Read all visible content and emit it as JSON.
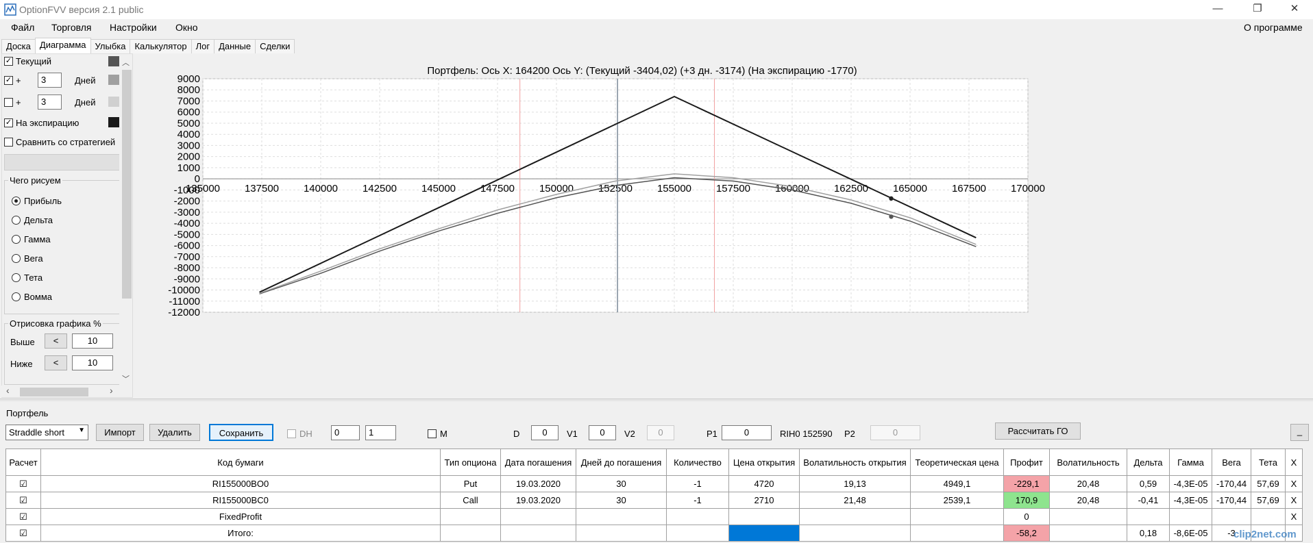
{
  "window": {
    "title": "OptionFVV версия 2.1 public",
    "min": "—",
    "restore": "❐",
    "close": "✕"
  },
  "menu": {
    "items": [
      "Файл",
      "Торговля",
      "Настройки",
      "Окно"
    ],
    "about": "О программе"
  },
  "tabs": [
    "Доска",
    "Диаграмма",
    "Улыбка",
    "Калькулятор",
    "Лог",
    "Данные",
    "Сделки"
  ],
  "left": {
    "current_label": "Текущий",
    "plus_label": "+",
    "days_label": "Дней",
    "days1": "3",
    "days2": "3",
    "expiration_label": "На экспирацию",
    "compare_label": "Сравнить со стратегией",
    "draw_group": "Чего рисуем",
    "draw_options": [
      "Прибыль",
      "Дельта",
      "Гамма",
      "Вега",
      "Тета",
      "Вомма"
    ],
    "render_group": "Отрисовка графика %",
    "above_label": "Выше",
    "below_label": "Ниже",
    "btn_less": "<",
    "above_value": "10",
    "below_value": "10",
    "scroll_up": "︿",
    "scroll_down": "﹀",
    "scroll_left": "‹",
    "scroll_right": "›",
    "colors": {
      "current": "#555555",
      "plus1": "#a0a0a0",
      "plus2": "#d0d0d0",
      "expiration": "#1a1a1a"
    }
  },
  "chart_data": {
    "type": "line",
    "title": "Портфель: Ось X: 164200 Ось Y:  (Текущий -3404,02)  (+3 дн. -3174)  (На экспирацию -1770)",
    "xlim": [
      135000,
      170000
    ],
    "ylim": [
      -12000,
      9000
    ],
    "x_ticks": [
      135000,
      137500,
      140000,
      142500,
      145000,
      147500,
      150000,
      152500,
      155000,
      157500,
      160000,
      162500,
      165000,
      167500,
      170000
    ],
    "y_ticks": [
      9000,
      8000,
      7000,
      6000,
      5000,
      4000,
      3000,
      2000,
      1000,
      0,
      -1000,
      -2000,
      -3000,
      -4000,
      -5000,
      -6000,
      -7000,
      -8000,
      -9000,
      -10000,
      -11000,
      -12000
    ],
    "vlines": {
      "current_price": 152590,
      "red_left": 148450,
      "red_right": 156700
    },
    "series": [
      {
        "x": [
          137400,
          155000,
          167800
        ],
        "y": [
          -10200,
          7400,
          -5300
        ]
      },
      {
        "x": [
          137400,
          140000,
          142500,
          145000,
          147500,
          150000,
          152500,
          155000,
          157500,
          160000,
          162500,
          165000,
          167800
        ],
        "y": [
          -10350,
          -8500,
          -6500,
          -4700,
          -3100,
          -1700,
          -600,
          100,
          -200,
          -1000,
          -2200,
          -3800,
          -6100
        ]
      },
      {
        "x": [
          137400,
          140000,
          142500,
          145000,
          147500,
          150000,
          152500,
          155000,
          157500,
          160000,
          162500,
          165000,
          167800
        ],
        "y": [
          -10300,
          -8300,
          -6300,
          -4500,
          -2800,
          -1400,
          -200,
          450,
          100,
          -700,
          -1900,
          -3500,
          -5900
        ]
      }
    ],
    "markers": [
      {
        "x": 164200,
        "y": -1770
      },
      {
        "x": 164200,
        "y": -3404
      }
    ]
  },
  "portfolio": {
    "label": "Портфель",
    "strategy": "Straddle short",
    "import": "Импорт",
    "delete": "Удалить",
    "save": "Сохранить",
    "dh": "DH",
    "spin1": "0",
    "spin2": "1",
    "m": "M",
    "d_label": "D",
    "d_value": "0",
    "v1_label": "V1",
    "v1_value": "0",
    "v2_label": "V2",
    "v2_value": "0",
    "p1_label": "P1",
    "p1_value": "0",
    "rih": "RIH0 152590",
    "p2_label": "P2",
    "p2_value": "0",
    "calc_go": "Рассчитать ГО",
    "collapse": "_"
  },
  "table": {
    "headers": [
      "Расчет",
      "Код бумаги",
      "Тип опциона",
      "Дата погашения",
      "Дней до погашения",
      "Количество",
      "Цена открытия",
      "Волатильность открытия",
      "Теоретическая цена",
      "Профит",
      "Волатильность",
      "Дельта",
      "Гамма",
      "Вега",
      "Тета",
      "X"
    ],
    "rows": [
      [
        "☑",
        "RI155000BO0",
        "Put",
        "19.03.2020",
        "30",
        "-1",
        "4720",
        "19,13",
        "4949,1",
        "-229,1",
        "20,48",
        "0,59",
        "-4,3E-05",
        "-170,44",
        "57,69",
        "X"
      ],
      [
        "☑",
        "RI155000BC0",
        "Call",
        "19.03.2020",
        "30",
        "-1",
        "2710",
        "21,48",
        "2539,1",
        "170,9",
        "20,48",
        "-0,41",
        "-4,3E-05",
        "-170,44",
        "57,69",
        "X"
      ],
      [
        "☑",
        "FixedProfit",
        "",
        "",
        "",
        "",
        "",
        "",
        "",
        "0",
        "",
        "",
        "",
        "",
        "",
        "X"
      ],
      [
        "☑",
        "Итого:",
        "",
        "",
        "",
        "",
        "",
        "",
        "",
        "-58,2",
        "",
        "0,18",
        "-8,6E-05",
        "-3",
        "",
        ""
      ]
    ]
  },
  "watermark": "clip2net.com"
}
